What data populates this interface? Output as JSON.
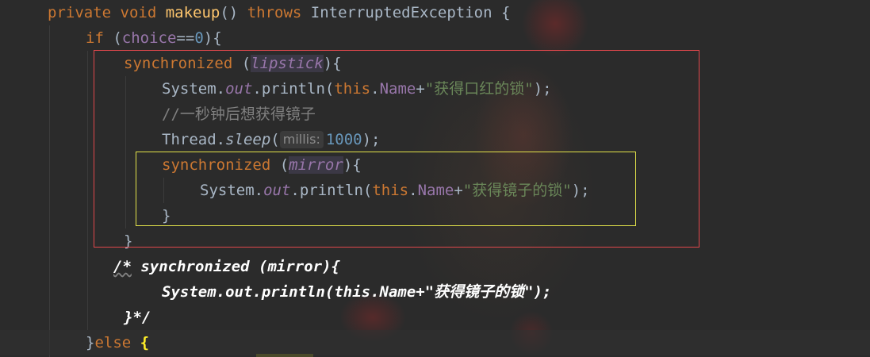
{
  "code": {
    "l1": {
      "kw1": "private ",
      "kw2": "void ",
      "method": "makeup",
      "p1": "() ",
      "kw3": "throws ",
      "p2": "InterruptedException {"
    },
    "l2": {
      "kw": "if ",
      "p1": "(",
      "field": "choice",
      "p2": "==",
      "num": "0",
      "p3": "){"
    },
    "l3": {
      "kw": "synchronized ",
      "p1": "(",
      "field": "lipstick",
      "p2": "){"
    },
    "l4": {
      "p1": "System.",
      "out": "out",
      "p2": ".println(",
      "kw": "this",
      "p3": ".",
      "field": "Name",
      "p4": "+",
      "str": "\"获得口红的锁\"",
      "p5": ");"
    },
    "l5": {
      "comment": "//一秒钟后想获得镜子"
    },
    "l6": {
      "p1": "Thread.",
      "sleep": "sleep",
      "p2": "(",
      "hint": "millis:",
      "num": "1000",
      "p3": ");"
    },
    "l7": {
      "kw": "synchronized ",
      "p1": "(",
      "field": "mirror",
      "p2": "){"
    },
    "l8": {
      "p1": "System.",
      "out": "out",
      "p2": ".println(",
      "kw": "this",
      "p3": ".",
      "field": "Name",
      "p4": "+",
      "str": "\"获得镜子的锁\"",
      "p5": ");"
    },
    "l9": {
      "brace": "}"
    },
    "l10": {
      "brace": "}"
    },
    "l11": {
      "open": "/*",
      "rest": " synchronized (mirror){"
    },
    "l12": {
      "text": "System.out.println(this.Name+\"获得镜子的锁\");"
    },
    "l13": {
      "text": "}*/"
    },
    "l14": {
      "p1": "}",
      "kw": "else ",
      "brace": "{"
    }
  },
  "colors": {
    "background": "#2b2b2b",
    "keyword": "#cc7832",
    "method": "#ffc66d",
    "field": "#9876aa",
    "number": "#6897bb",
    "string": "#6a8759",
    "comment": "#808080",
    "annotation_box_outer": "#e0484c",
    "annotation_box_inner": "#e3e34a"
  }
}
